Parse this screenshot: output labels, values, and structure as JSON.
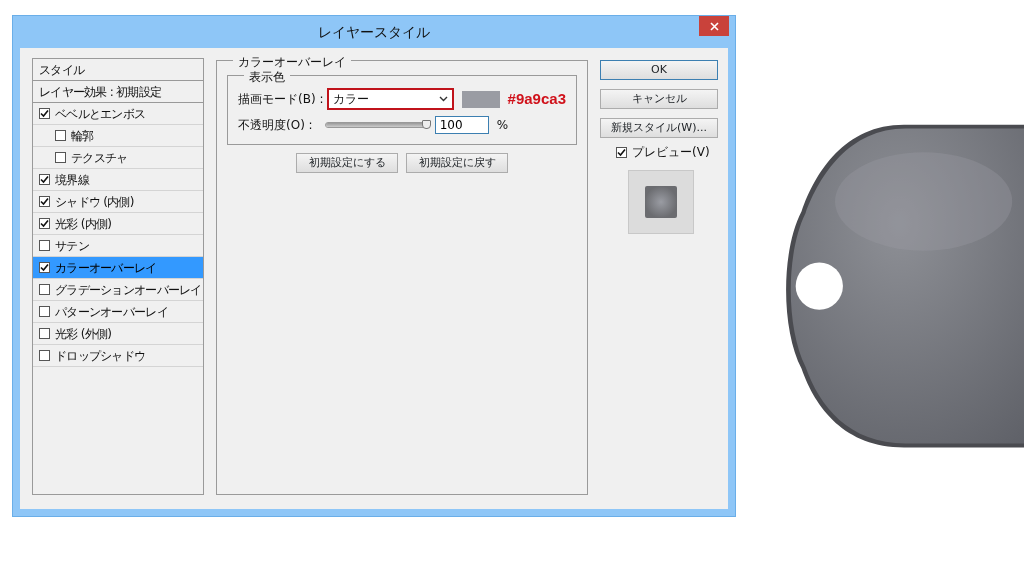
{
  "window": {
    "title": "レイヤースタイル"
  },
  "styles_panel": {
    "title": "スタイル",
    "blending_options": "レイヤー効果 : 初期設定",
    "effects": [
      {
        "label": "ベベルとエンボス",
        "checked": true,
        "selected": false,
        "children": [
          {
            "label": "輪郭",
            "checked": false,
            "selected": false
          },
          {
            "label": "テクスチャ",
            "checked": false,
            "selected": false
          }
        ]
      },
      {
        "label": "境界線",
        "checked": true,
        "selected": false
      },
      {
        "label": "シャドウ (内側)",
        "checked": true,
        "selected": false
      },
      {
        "label": "光彩 (内側)",
        "checked": true,
        "selected": false
      },
      {
        "label": "サテン",
        "checked": false,
        "selected": false
      },
      {
        "label": "カラーオーバーレイ",
        "checked": true,
        "selected": true
      },
      {
        "label": "グラデーションオーバーレイ",
        "checked": false,
        "selected": false
      },
      {
        "label": "パターンオーバーレイ",
        "checked": false,
        "selected": false
      },
      {
        "label": "光彩 (外側)",
        "checked": false,
        "selected": false
      },
      {
        "label": "ドロップシャドウ",
        "checked": false,
        "selected": false
      }
    ]
  },
  "color_overlay": {
    "group_title": "カラーオーバーレイ",
    "subgroup_title": "表示色",
    "blend_mode": {
      "label": "描画モード(B) :",
      "value": "カラー"
    },
    "swatch": {
      "color": "#9a9ca3"
    },
    "color_annotation": "#9a9ca3",
    "opacity": {
      "label": "不透明度(O) :",
      "level": 1,
      "value": "100",
      "unit": "%"
    },
    "buttons": [
      "初期設定にする",
      "初期設定に戻す"
    ]
  },
  "actions": {
    "ok": "OK",
    "cancel": "キャンセル",
    "new_style": "新規スタイル(W)...",
    "preview": {
      "label": "プレビュー(V)",
      "checked": true
    }
  }
}
